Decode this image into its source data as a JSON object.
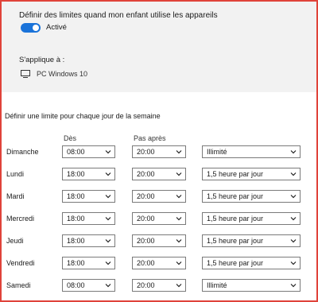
{
  "header": {
    "title": "Définir des limites quand mon enfant utilise les appareils",
    "toggle_label": "Activé",
    "toggle_on": true,
    "applies_label": "S'applique à :",
    "device_icon": "monitor-icon",
    "device_name": "PC Windows 10"
  },
  "schedule": {
    "title": "Définir une limite pour chaque jour de la semaine",
    "col_from": "Dès",
    "col_until": "Pas après",
    "chevron_icon": "chevron-down-icon",
    "days": [
      {
        "name": "Dimanche",
        "from": "08:00",
        "until": "20:00",
        "limit": "Illimité"
      },
      {
        "name": "Lundi",
        "from": "18:00",
        "until": "20:00",
        "limit": "1,5 heure par jour"
      },
      {
        "name": "Mardi",
        "from": "18:00",
        "until": "20:00",
        "limit": "1,5 heure par jour"
      },
      {
        "name": "Mercredi",
        "from": "18:00",
        "until": "20:00",
        "limit": "1,5 heure par jour"
      },
      {
        "name": "Jeudi",
        "from": "18:00",
        "until": "20:00",
        "limit": "1,5 heure par jour"
      },
      {
        "name": "Vendredi",
        "from": "18:00",
        "until": "20:00",
        "limit": "1,5 heure par jour"
      },
      {
        "name": "Samedi",
        "from": "08:00",
        "until": "20:00",
        "limit": "Illimité"
      }
    ]
  },
  "colors": {
    "accent": "#1a73d9",
    "frame": "#e0433a",
    "panel": "#f2f2f2"
  }
}
